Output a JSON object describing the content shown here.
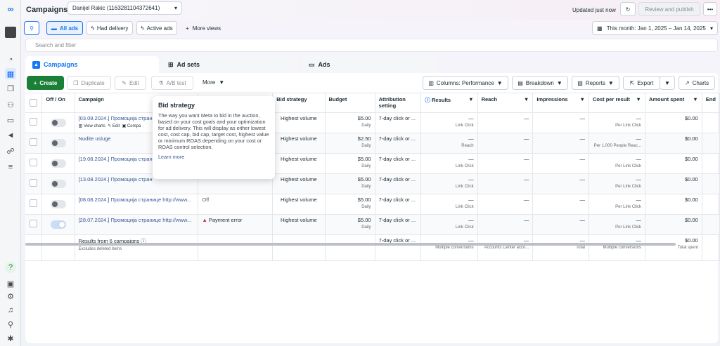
{
  "header": {
    "title": "Campaigns",
    "account": "Danijel Rakic (1163281104372641)",
    "updated": "Updated just now",
    "review_publish": "Review and publish",
    "more": "•••"
  },
  "filters": {
    "all_ads": "All ads",
    "had_delivery": "Had delivery",
    "active_ads": "Active ads",
    "more_views": "More views",
    "date_range": "This month: Jan 1, 2025 – Jan 14, 2025",
    "search_placeholder": "Search and filter"
  },
  "tabs": {
    "campaigns": "Campaigns",
    "ad_sets": "Ad sets",
    "ads": "Ads"
  },
  "toolbar": {
    "create": "Create",
    "duplicate": "Duplicate",
    "edit": "Edit",
    "ab_test": "A/B test",
    "more": "More",
    "columns": "Columns: Performance",
    "breakdown": "Breakdown",
    "reports": "Reports",
    "export": "Export",
    "charts": "Charts"
  },
  "table": {
    "columns": [
      "Off / On",
      "Campaign",
      "Bid strategy",
      "Budget",
      "Attribution setting",
      "Results",
      "Reach",
      "Impressions",
      "Cost per result",
      "Amount spent",
      "End"
    ],
    "rows": [
      {
        "campaign": "[03.09.2024.] Промоција страниц",
        "on": false,
        "delivery": "",
        "bid": "Highest volume",
        "budget": "$5.00",
        "budget_sub": "Daily",
        "attr": "7-day click or ...",
        "results": "—",
        "results_sub": "Link Click",
        "reach": "—",
        "reach_sub": "",
        "impr": "—",
        "cpr": "—",
        "cpr_sub": "Per Link Click",
        "spent": "$0.00"
      },
      {
        "campaign": "Nudite usluge",
        "on": false,
        "delivery": "",
        "bid": "Highest volume",
        "budget": "$2.50",
        "budget_sub": "Daily",
        "attr": "7-day click or ...",
        "results": "—",
        "results_sub": "Reach",
        "reach": "—",
        "reach_sub": "",
        "impr": "—",
        "cpr": "—",
        "cpr_sub": "Per 1,000 People Reac...",
        "spent": "$0.00"
      },
      {
        "campaign": "[19.08.2024.] Промоција стран",
        "on": false,
        "delivery": "",
        "bid": "Highest volume",
        "budget": "$5.00",
        "budget_sub": "Daily",
        "attr": "7-day click or ...",
        "results": "—",
        "results_sub": "Link Click",
        "reach": "—",
        "reach_sub": "",
        "impr": "—",
        "cpr": "—",
        "cpr_sub": "Per Link Click",
        "spent": "$0.00"
      },
      {
        "campaign": "[13.08.2024.] Промоција стран",
        "on": false,
        "delivery": "",
        "bid": "Highest volume",
        "budget": "$5.00",
        "budget_sub": "Daily",
        "attr": "7-day click or ...",
        "results": "—",
        "results_sub": "Link Click",
        "reach": "—",
        "reach_sub": "",
        "impr": "—",
        "cpr": "—",
        "cpr_sub": "Per Link Click",
        "spent": "$0.00"
      },
      {
        "campaign": "[08.08.2024.] Промоција странице http://www...",
        "on": false,
        "delivery": "Off",
        "bid": "Highest volume",
        "budget": "$5.00",
        "budget_sub": "Daily",
        "attr": "7-day click or ...",
        "results": "—",
        "results_sub": "Link Click",
        "reach": "—",
        "reach_sub": "",
        "impr": "—",
        "cpr": "—",
        "cpr_sub": "Per Link Click",
        "spent": "$0.00"
      },
      {
        "campaign": "[28.07.2024.] Промоција странице http://www...",
        "on": true,
        "delivery": "Payment error",
        "bid": "Highest volume",
        "budget": "$5.00",
        "budget_sub": "Daily",
        "attr": "7-day click or ...",
        "results": "—",
        "results_sub": "Link Click",
        "reach": "—",
        "reach_sub": "",
        "impr": "—",
        "cpr": "—",
        "cpr_sub": "Per Link Click",
        "spent": "$0.00"
      }
    ],
    "row_actions": {
      "view_charts": "View charts",
      "edit": "Edit",
      "compare": "Compa"
    },
    "summary": {
      "label": "Results from 6 campaigns",
      "sub": "Excludes deleted items",
      "attr": "7-day click or ...",
      "results": "—",
      "results_sub": "Multiple conversions",
      "reach": "—",
      "reach_sub": "Accounts Center acco...",
      "impr": "—",
      "impr_sub": "Total",
      "cpr": "—",
      "cpr_sub": "Multiple conversions",
      "spent": "$0.00",
      "spent_sub": "Total spent"
    }
  },
  "tooltip": {
    "title": "Bid strategy",
    "body": "The way you want Meta to bid in the auction, based on your cost goals and your optimization for ad delivery. This will display as either lowest cost, cost cap, bid cap, target cost, highest value or minimum ROAS depending on your cost or ROAS control selection.",
    "link": "Learn more"
  },
  "colors": {
    "create_green": "#1a7f37",
    "tab_active": "#1877f2",
    "error_red": "#e41e3f"
  }
}
